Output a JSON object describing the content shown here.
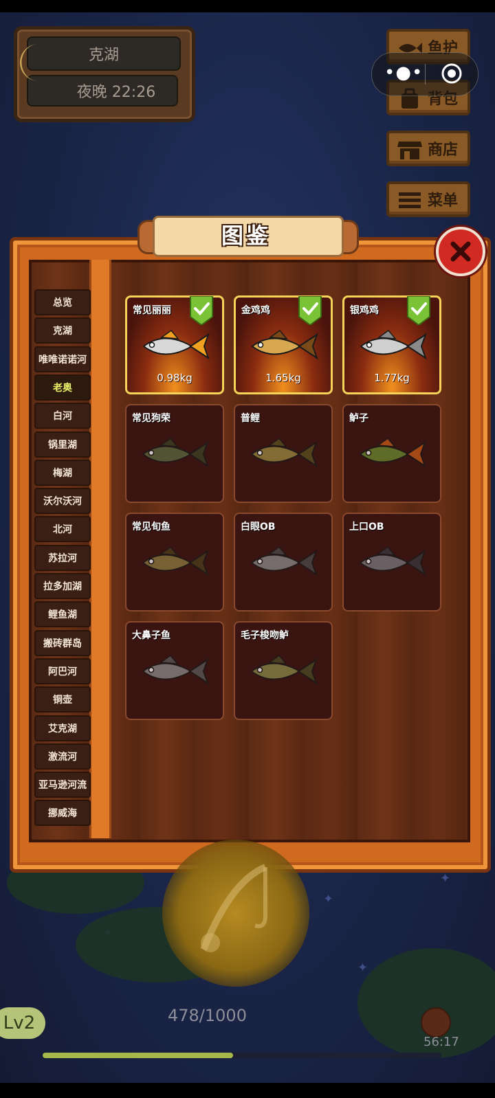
{
  "location_panel": {
    "lake": "克湖",
    "time": "夜晚 22:26"
  },
  "side_buttons": [
    {
      "id": "fish-guide",
      "label": "鱼护",
      "icon": "fish-icon"
    },
    {
      "id": "backpack",
      "label": "背包",
      "icon": "backpack-icon"
    },
    {
      "id": "shop",
      "label": "商店",
      "icon": "shop-icon"
    },
    {
      "id": "menu",
      "label": "菜单",
      "icon": "menu-icon"
    }
  ],
  "capsule": {
    "more_icon": "more-dots-icon",
    "close_icon": "target-icon"
  },
  "modal": {
    "title": "图鉴",
    "locations": [
      "总览",
      "克湖",
      "唯唯诺诺河",
      "老奥",
      "白河",
      "锅里湖",
      "梅湖",
      "沃尔沃河",
      "北河",
      "苏拉河",
      "拉多加湖",
      "鲤鱼湖",
      "搬砖群岛",
      "阿巴河",
      "铜壶",
      "艾克湖",
      "激流河",
      "亚马逊河流",
      "挪威海"
    ],
    "active_location": "老奥",
    "fish": [
      {
        "name": "常见丽丽",
        "weight": "0.98kg",
        "caught": true,
        "colors": [
          "#d8d8d8",
          "#f0a020"
        ]
      },
      {
        "name": "金鸡鸡",
        "weight": "1.65kg",
        "caught": true,
        "colors": [
          "#d8a850",
          "#7a4a18"
        ]
      },
      {
        "name": "银鸡鸡",
        "weight": "1.77kg",
        "caught": true,
        "colors": [
          "#cfcfcf",
          "#8a8a8a"
        ]
      },
      {
        "name": "常见狗荣",
        "weight": "",
        "caught": false,
        "colors": [
          "#5a6a40",
          "#3a4226"
        ]
      },
      {
        "name": "普鲤",
        "weight": "",
        "caught": false,
        "colors": [
          "#9a8a40",
          "#5a5220"
        ]
      },
      {
        "name": "鲈子",
        "weight": "",
        "caught": false,
        "colors": [
          "#6a8a30",
          "#c85a18"
        ]
      },
      {
        "name": "常见旬鱼",
        "weight": "",
        "caught": false,
        "colors": [
          "#8a7a40",
          "#4a3e1e"
        ]
      },
      {
        "name": "白眼OB",
        "weight": "",
        "caught": false,
        "colors": [
          "#8a8a8a",
          "#4a4a4a"
        ]
      },
      {
        "name": "上口OB",
        "weight": "",
        "caught": false,
        "colors": [
          "#7a7a80",
          "#3a3a40"
        ]
      },
      {
        "name": "大鼻子鱼",
        "weight": "",
        "caught": false,
        "colors": [
          "#8a8a8a",
          "#5a5a5a"
        ]
      },
      {
        "name": "毛子梭吻鲈",
        "weight": "",
        "caught": false,
        "colors": [
          "#8a8a4a",
          "#4a4a24"
        ]
      }
    ]
  },
  "hud": {
    "level": "Lv2",
    "xp": "478/1000",
    "xp_fraction": 0.478,
    "bait_time": "56:17"
  }
}
